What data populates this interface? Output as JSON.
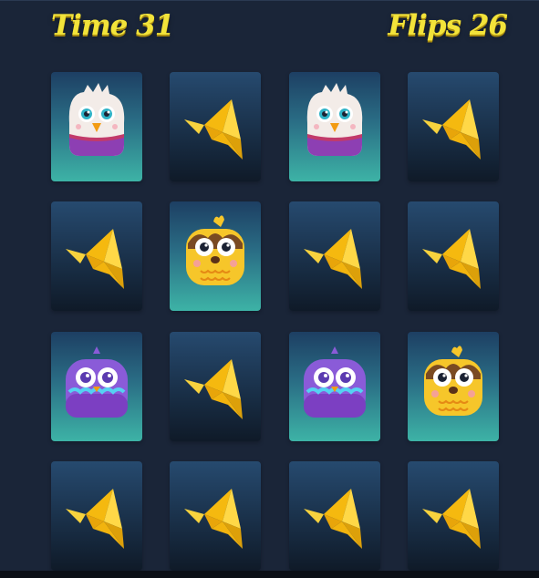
{
  "hud": {
    "time_label": "Time 31",
    "flips_label": "Flips 26"
  },
  "board": {
    "rows": 4,
    "cols": 4,
    "cards": [
      {
        "state": "face-up",
        "icon": "eagle-icon"
      },
      {
        "state": "face-down",
        "icon": "paper-bird-icon"
      },
      {
        "state": "face-up",
        "icon": "eagle-icon"
      },
      {
        "state": "face-down",
        "icon": "paper-bird-icon"
      },
      {
        "state": "face-down",
        "icon": "paper-bird-icon"
      },
      {
        "state": "face-up",
        "icon": "yellow-owl-icon"
      },
      {
        "state": "face-down",
        "icon": "paper-bird-icon"
      },
      {
        "state": "face-down",
        "icon": "paper-bird-icon"
      },
      {
        "state": "face-up",
        "icon": "purple-owl-icon"
      },
      {
        "state": "face-down",
        "icon": "paper-bird-icon"
      },
      {
        "state": "face-up",
        "icon": "purple-owl-icon"
      },
      {
        "state": "face-up",
        "icon": "yellow-owl-icon"
      },
      {
        "state": "face-down",
        "icon": "paper-bird-icon"
      },
      {
        "state": "face-down",
        "icon": "paper-bird-icon"
      },
      {
        "state": "face-down",
        "icon": "paper-bird-icon"
      },
      {
        "state": "face-down",
        "icon": "paper-bird-icon"
      }
    ]
  },
  "colors": {
    "background": "#1a2538",
    "hud_text": "#f2e33a",
    "card_back": "#1b3350",
    "card_front_top": "#1d3f63",
    "card_front_bottom": "#3db3a6",
    "bird": "#f5c21b",
    "eagle": "#f2ece9",
    "yellow_owl": "#f6c62a",
    "purple_owl": "#8a5bd8"
  }
}
